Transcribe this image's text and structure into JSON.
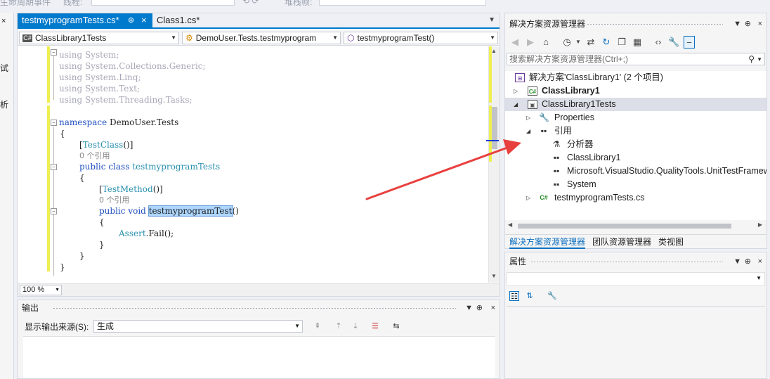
{
  "top_strip": {
    "left_text": "生命周期事件",
    "mid_text": "线程:",
    "stack_text": "堆栈帧:"
  },
  "left_sliver": {
    "chars": [
      "试",
      "析"
    ]
  },
  "editor": {
    "tabs": [
      {
        "label": "testmyprogramTests.cs*",
        "pin": "⊕",
        "close": "×"
      },
      {
        "label": "Class1.cs*"
      }
    ],
    "overflow_icon": "▼",
    "nav": {
      "project": "ClassLibrary1Tests",
      "type": "DemoUser.Tests.testmyprogram",
      "member": "testmyprogramTest()"
    },
    "code": {
      "using1": "using System;",
      "using2": "using System.Collections.Generic;",
      "using3": "using System.Linq;",
      "using4": "using System.Text;",
      "using5": "using System.Threading.Tasks;",
      "ns_kw": "namespace",
      "ns_name": " DemoUser.Tests",
      "brace_open": "{",
      "attr_class": "TestClass",
      "ref_count_1": "0 个引用",
      "public_kw": "public",
      "class_kw": "class",
      "class_name": "testmyprogramTests",
      "attr_method": "TestMethod",
      "ref_count_2": "0 个引用",
      "void_kw": "void",
      "method_name": "testmyprogramTest",
      "assert_type": "Assert",
      "assert_call": ".Fail();",
      "brace_close": "}"
    },
    "zoom": "100 %"
  },
  "output": {
    "title": "输出",
    "source_label": "显示输出来源(S):",
    "source_value": "生成"
  },
  "solution_explorer": {
    "title": "解决方案资源管理器",
    "search_placeholder": "搜索解决方案资源管理器(Ctrl+;)",
    "tree": [
      {
        "label": "解决方案'ClassLibrary1' (2 个项目)"
      },
      {
        "label": "ClassLibrary1"
      },
      {
        "label": "ClassLibrary1Tests"
      },
      {
        "label": "Properties"
      },
      {
        "label": "引用"
      },
      {
        "label": "分析器"
      },
      {
        "label": "ClassLibrary1"
      },
      {
        "label": "Microsoft.VisualStudio.QualityTools.UnitTestFramework"
      },
      {
        "label": "System"
      },
      {
        "label": "testmyprogramTests.cs"
      }
    ],
    "bottom_tabs": [
      "解决方案资源管理器",
      "团队资源管理器",
      "类视图"
    ]
  },
  "properties": {
    "title": "属性"
  },
  "colors": {
    "accent": "#007acc",
    "annotation_arrow": "#e8403f",
    "selection": "#add6ff"
  }
}
